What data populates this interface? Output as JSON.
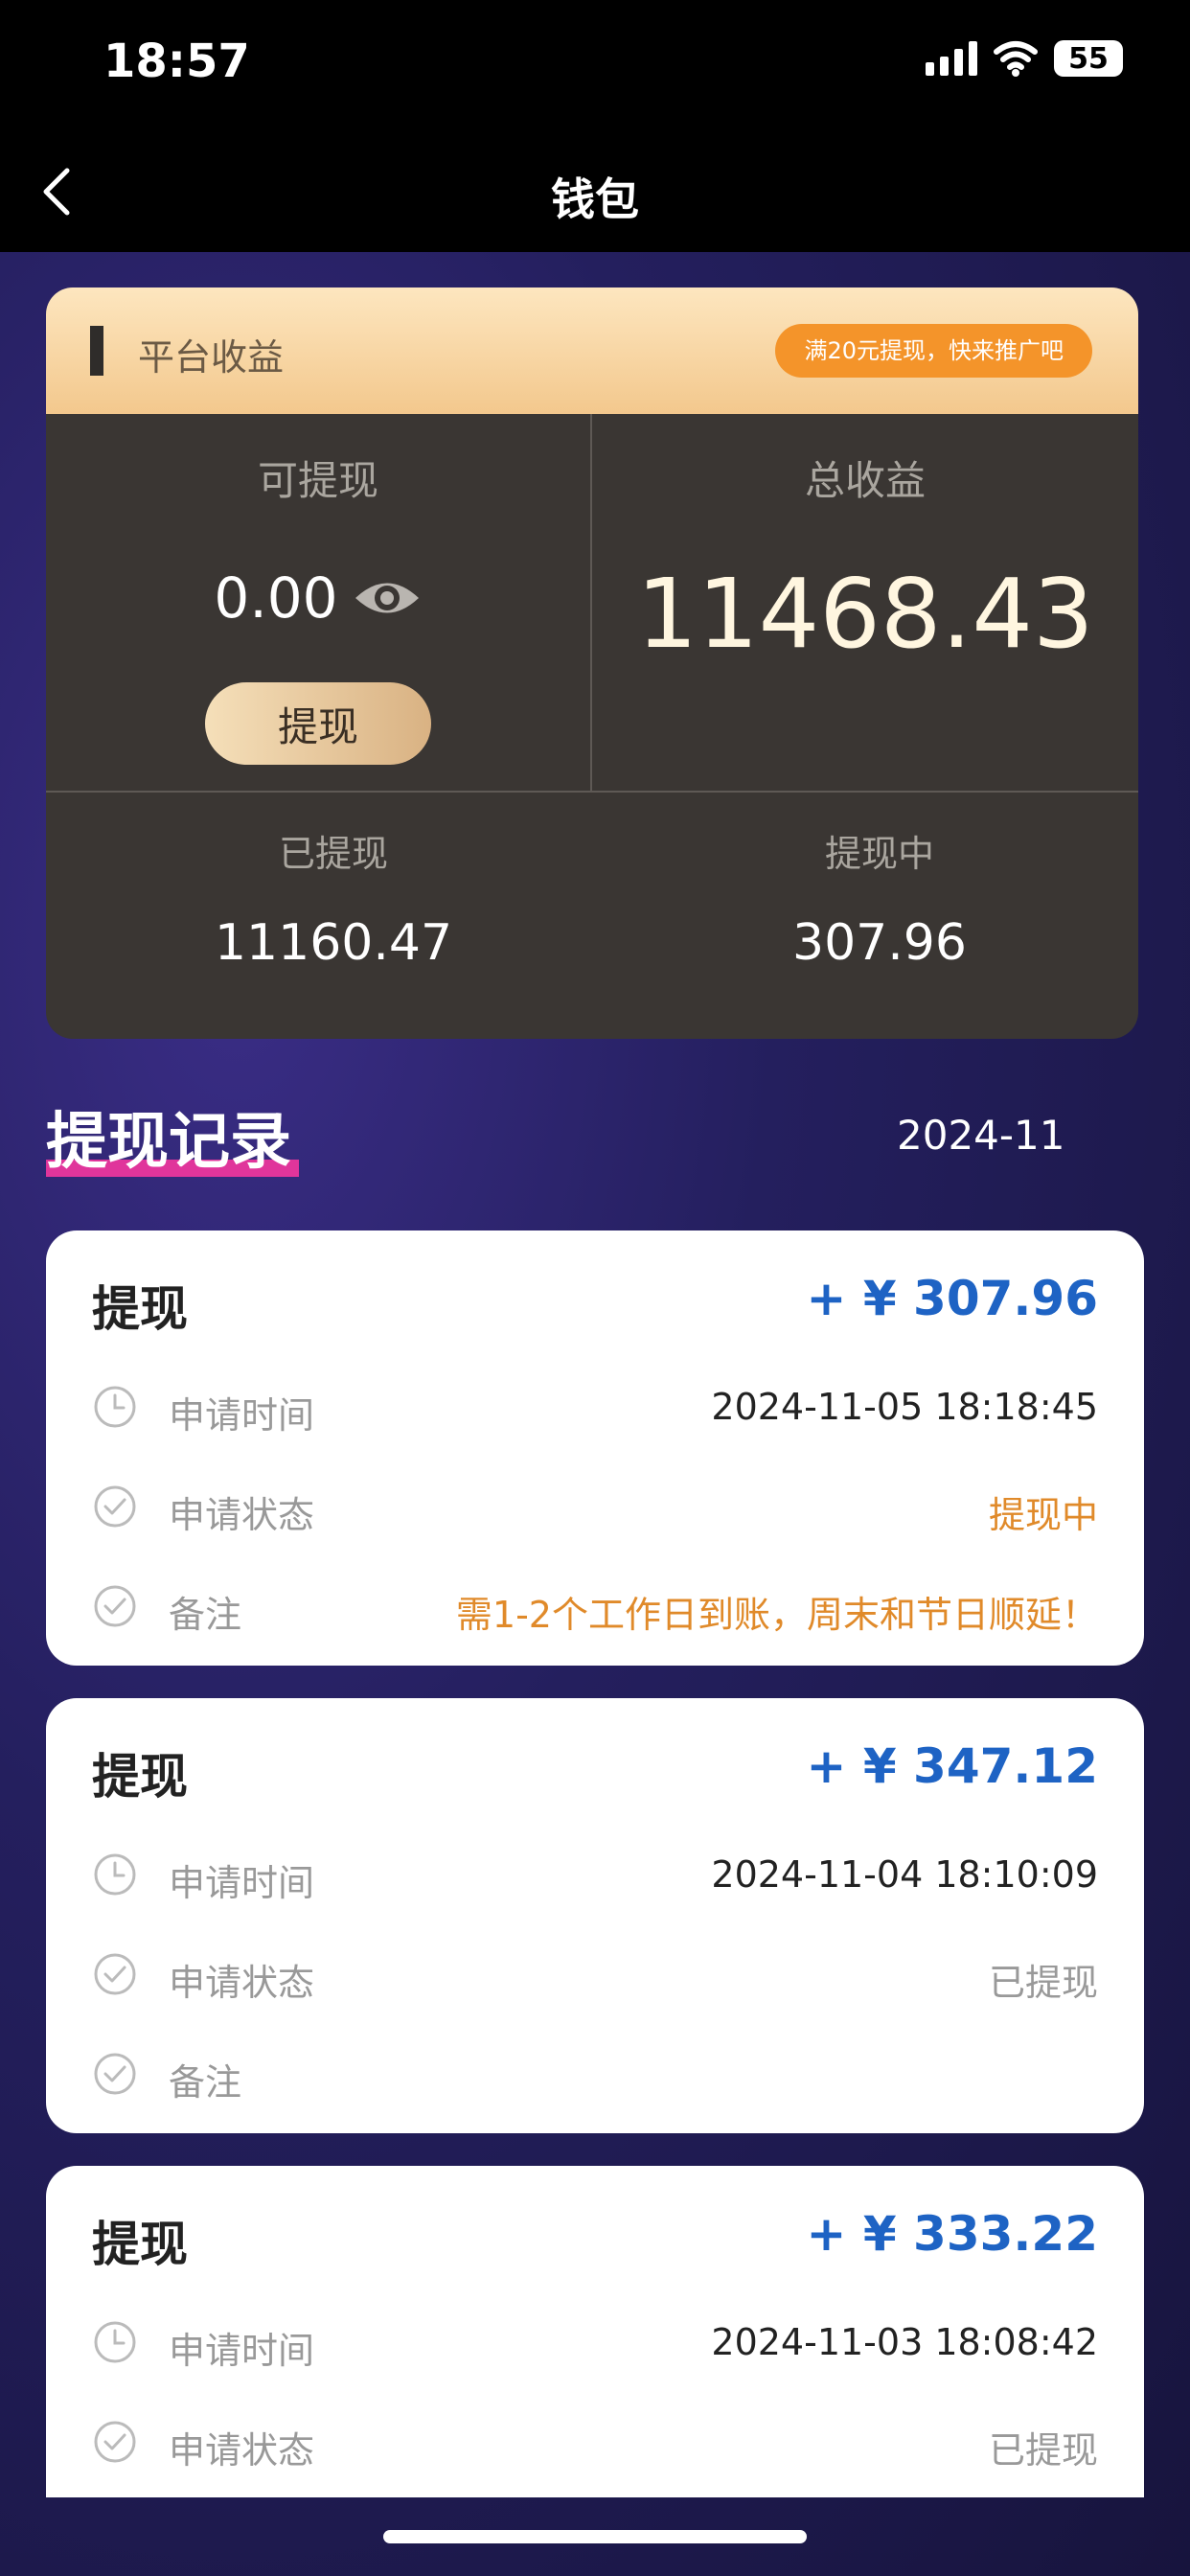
{
  "status_bar": {
    "time": "18:57",
    "battery": "55"
  },
  "nav": {
    "title": "钱包"
  },
  "wallet": {
    "header_title": "平台收益",
    "promo": "满20元提现，快来推广吧",
    "available_label": "可提现",
    "available_value": "0.00",
    "withdraw_button": "提现",
    "total_label": "总收益",
    "total_value": "11468.43",
    "withdrawn_label": "已提现",
    "withdrawn_value": "11160.47",
    "pending_label": "提现中",
    "pending_value": "307.96"
  },
  "records": {
    "title": "提现记录",
    "month": "2024-11",
    "items": [
      {
        "title": "提现",
        "amount": "+ ¥ 307.96",
        "time_label": "申请时间",
        "time": "2024-11-05 18:18:45",
        "status_label": "申请状态",
        "status": "提现中",
        "note_label": "备注",
        "note": "需1-2个工作日到账，周末和节日顺延！"
      },
      {
        "title": "提现",
        "amount": "+ ¥ 347.12",
        "time_label": "申请时间",
        "time": "2024-11-04 18:10:09",
        "status_label": "申请状态",
        "status": "已提现",
        "note_label": "备注",
        "note": ""
      },
      {
        "title": "提现",
        "amount": "+ ¥ 333.22",
        "time_label": "申请时间",
        "time": "2024-11-03 18:08:42",
        "status_label": "申请状态",
        "status": "已提现"
      }
    ]
  },
  "colors": {
    "accent_blue": "#1e63c4",
    "accent_orange": "#e08a2a",
    "promo_orange": "#f4942a",
    "underline_pink": "#e0359b"
  }
}
